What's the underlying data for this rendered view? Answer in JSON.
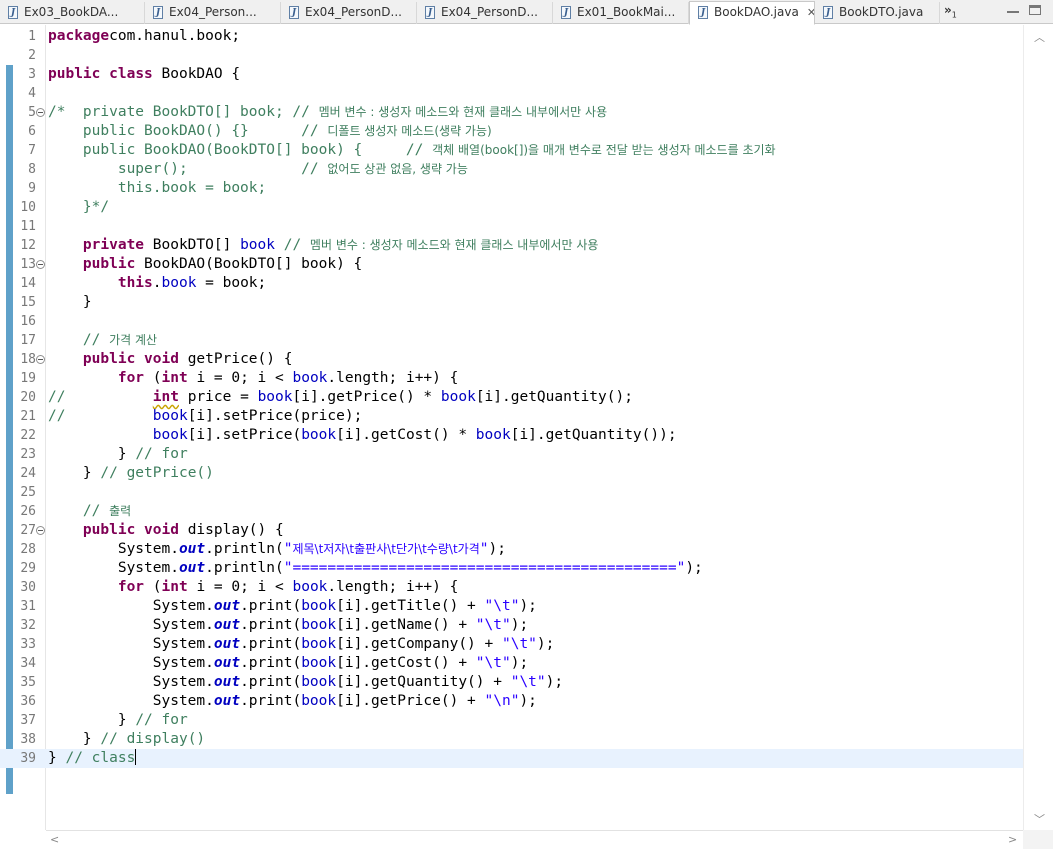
{
  "tabs": [
    {
      "label": "Ex03_BookDA...",
      "active": false
    },
    {
      "label": "Ex04_Person...",
      "active": false
    },
    {
      "label": "Ex04_PersonD...",
      "active": false
    },
    {
      "label": "Ex04_PersonD...",
      "active": false
    },
    {
      "label": "Ex01_BookMai...",
      "active": false
    },
    {
      "label": "BookDAO.java",
      "active": true
    },
    {
      "label": "BookDTO.java",
      "active": false
    }
  ],
  "tab_overflow": {
    "glyph": "»",
    "count": "1"
  },
  "editor": {
    "current_line": 39,
    "folding_lines": [
      5,
      13,
      18,
      27
    ],
    "lines": [
      {
        "n": "1",
        "tokens": [
          [
            "kw",
            "package"
          ],
          [
            "",
            "com.hanul.book;"
          ]
        ]
      },
      {
        "n": "2",
        "tokens": []
      },
      {
        "n": "3",
        "tokens": [
          [
            "kw",
            "public"
          ],
          [
            "",
            " "
          ],
          [
            "kw",
            "class"
          ],
          [
            "",
            " BookDAO {"
          ]
        ]
      },
      {
        "n": "4",
        "tokens": []
      },
      {
        "n": "5",
        "tokens": [
          [
            "cm",
            "/*  private BookDTO[] book; // "
          ],
          [
            "cmkr",
            "멤버 변수 : 생성자 메소드와 현재 클래스 내부에서만 사용"
          ]
        ]
      },
      {
        "n": "6",
        "tokens": [
          [
            "cm",
            "    public BookDAO() {}      // "
          ],
          [
            "cmkr",
            "디폴트 생성자 메소드(생략 가능)"
          ]
        ]
      },
      {
        "n": "7",
        "tokens": [
          [
            "cm",
            "    public BookDAO(BookDTO[] book) {     // "
          ],
          [
            "cmkr",
            "객체 배열(book[])을 매개 변수로 전달 받는 생성자 메소드를 초기화"
          ]
        ]
      },
      {
        "n": "8",
        "tokens": [
          [
            "cm",
            "        super();             // "
          ],
          [
            "cmkr",
            "없어도 상관 없음, 생략 가능"
          ]
        ]
      },
      {
        "n": "9",
        "tokens": [
          [
            "cm",
            "        this.book = book;"
          ]
        ]
      },
      {
        "n": "10",
        "tokens": [
          [
            "cm",
            "    }*/"
          ]
        ]
      },
      {
        "n": "11",
        "tokens": []
      },
      {
        "n": "12",
        "tokens": [
          [
            "",
            "    "
          ],
          [
            "kw",
            "private"
          ],
          [
            "",
            " BookDTO[] "
          ],
          [
            "fd",
            "book"
          ],
          [
            "",
            " "
          ],
          [
            "cm",
            "// "
          ],
          [
            "cmkr",
            "멤버 변수 : 생성자 메소드와 현재 클래스 내부에서만 사용"
          ]
        ]
      },
      {
        "n": "13",
        "tokens": [
          [
            "",
            "    "
          ],
          [
            "kw",
            "public"
          ],
          [
            "",
            " BookDAO(BookDTO[] book) {"
          ]
        ]
      },
      {
        "n": "14",
        "tokens": [
          [
            "",
            "        "
          ],
          [
            "kw",
            "this"
          ],
          [
            "",
            "."
          ],
          [
            "fd",
            "book"
          ],
          [
            "",
            " = book;"
          ]
        ]
      },
      {
        "n": "15",
        "tokens": [
          [
            "",
            "    }"
          ]
        ]
      },
      {
        "n": "16",
        "tokens": []
      },
      {
        "n": "17",
        "tokens": [
          [
            "",
            "    "
          ],
          [
            "cm",
            "// "
          ],
          [
            "cmkr",
            "가격 계산"
          ]
        ]
      },
      {
        "n": "18",
        "tokens": [
          [
            "",
            "    "
          ],
          [
            "kw",
            "public"
          ],
          [
            "",
            " "
          ],
          [
            "kw",
            "void"
          ],
          [
            "",
            " getPrice() {"
          ]
        ]
      },
      {
        "n": "19",
        "tokens": [
          [
            "",
            "        "
          ],
          [
            "kw",
            "for"
          ],
          [
            "",
            " ("
          ],
          [
            "kw",
            "int"
          ],
          [
            "",
            " i = 0; i < "
          ],
          [
            "fd",
            "book"
          ],
          [
            "",
            ".length; i++) {"
          ]
        ]
      },
      {
        "n": "20",
        "tokens": [
          [
            "cm",
            "//"
          ],
          [
            "",
            "          "
          ],
          [
            "warnkw",
            "int"
          ],
          [
            "",
            " price = "
          ],
          [
            "fd",
            "book"
          ],
          [
            "",
            "[i].getPrice() * "
          ],
          [
            "fd",
            "book"
          ],
          [
            "",
            "[i].getQuantity();"
          ]
        ]
      },
      {
        "n": "21",
        "tokens": [
          [
            "cm",
            "//"
          ],
          [
            "",
            "          "
          ],
          [
            "fd",
            "book"
          ],
          [
            "",
            "[i].setPrice(price);"
          ]
        ]
      },
      {
        "n": "22",
        "tokens": [
          [
            "",
            "            "
          ],
          [
            "fd",
            "book"
          ],
          [
            "",
            "[i].setPrice("
          ],
          [
            "fd",
            "book"
          ],
          [
            "",
            "[i].getCost() * "
          ],
          [
            "fd",
            "book"
          ],
          [
            "",
            "[i].getQuantity());"
          ]
        ]
      },
      {
        "n": "23",
        "tokens": [
          [
            "",
            "        } "
          ],
          [
            "cm",
            "// for"
          ]
        ]
      },
      {
        "n": "24",
        "tokens": [
          [
            "",
            "    } "
          ],
          [
            "cm",
            "// getPrice()"
          ]
        ]
      },
      {
        "n": "25",
        "tokens": []
      },
      {
        "n": "26",
        "tokens": [
          [
            "",
            "    "
          ],
          [
            "cm",
            "// "
          ],
          [
            "cmkr",
            "출력"
          ]
        ]
      },
      {
        "n": "27",
        "tokens": [
          [
            "",
            "    "
          ],
          [
            "kw",
            "public"
          ],
          [
            "",
            " "
          ],
          [
            "kw",
            "void"
          ],
          [
            "",
            " display() {"
          ]
        ]
      },
      {
        "n": "28",
        "tokens": [
          [
            "",
            "        System."
          ],
          [
            "sf",
            "out"
          ],
          [
            "",
            ".println("
          ],
          [
            "st",
            "\""
          ],
          [
            "stkr",
            "제목\\t저자\\t출판사\\t단가\\t수량\\t가격"
          ],
          [
            "st",
            "\""
          ],
          [
            "",
            ");"
          ]
        ]
      },
      {
        "n": "29",
        "tokens": [
          [
            "",
            "        System."
          ],
          [
            "sf",
            "out"
          ],
          [
            "",
            ".println("
          ],
          [
            "st",
            "\"============================================\""
          ],
          [
            "",
            ");"
          ]
        ]
      },
      {
        "n": "30",
        "tokens": [
          [
            "",
            "        "
          ],
          [
            "kw",
            "for"
          ],
          [
            "",
            " ("
          ],
          [
            "kw",
            "int"
          ],
          [
            "",
            " i = 0; i < "
          ],
          [
            "fd",
            "book"
          ],
          [
            "",
            ".length; i++) {"
          ]
        ]
      },
      {
        "n": "31",
        "tokens": [
          [
            "",
            "            System."
          ],
          [
            "sf",
            "out"
          ],
          [
            "",
            ".print("
          ],
          [
            "fd",
            "book"
          ],
          [
            "",
            "[i].getTitle() + "
          ],
          [
            "st",
            "\"\\t\""
          ],
          [
            "",
            ");"
          ]
        ]
      },
      {
        "n": "32",
        "tokens": [
          [
            "",
            "            System."
          ],
          [
            "sf",
            "out"
          ],
          [
            "",
            ".print("
          ],
          [
            "fd",
            "book"
          ],
          [
            "",
            "[i].getName() + "
          ],
          [
            "st",
            "\"\\t\""
          ],
          [
            "",
            ");"
          ]
        ]
      },
      {
        "n": "33",
        "tokens": [
          [
            "",
            "            System."
          ],
          [
            "sf",
            "out"
          ],
          [
            "",
            ".print("
          ],
          [
            "fd",
            "book"
          ],
          [
            "",
            "[i].getCompany() + "
          ],
          [
            "st",
            "\"\\t\""
          ],
          [
            "",
            ");"
          ]
        ]
      },
      {
        "n": "34",
        "tokens": [
          [
            "",
            "            System."
          ],
          [
            "sf",
            "out"
          ],
          [
            "",
            ".print("
          ],
          [
            "fd",
            "book"
          ],
          [
            "",
            "[i].getCost() + "
          ],
          [
            "st",
            "\"\\t\""
          ],
          [
            "",
            ");"
          ]
        ]
      },
      {
        "n": "35",
        "tokens": [
          [
            "",
            "            System."
          ],
          [
            "sf",
            "out"
          ],
          [
            "",
            ".print("
          ],
          [
            "fd",
            "book"
          ],
          [
            "",
            "[i].getQuantity() + "
          ],
          [
            "st",
            "\"\\t\""
          ],
          [
            "",
            ");"
          ]
        ]
      },
      {
        "n": "36",
        "tokens": [
          [
            "",
            "            System."
          ],
          [
            "sf",
            "out"
          ],
          [
            "",
            ".print("
          ],
          [
            "fd",
            "book"
          ],
          [
            "",
            "[i].getPrice() + "
          ],
          [
            "st",
            "\"\\n\""
          ],
          [
            "",
            ");"
          ]
        ]
      },
      {
        "n": "37",
        "tokens": [
          [
            "",
            "        } "
          ],
          [
            "cm",
            "// for"
          ]
        ]
      },
      {
        "n": "38",
        "tokens": [
          [
            "",
            "    } "
          ],
          [
            "cm",
            "// display()"
          ]
        ]
      },
      {
        "n": "39",
        "tokens": [
          [
            "",
            "} "
          ],
          [
            "cm",
            "// class"
          ]
        ]
      }
    ]
  },
  "colors": {
    "keyword": "#7f0055",
    "comment": "#3f7f5f",
    "field": "#0000c0",
    "string": "#2a00ff",
    "current_line_bg": "#e8f2fe",
    "change_bar": "#5fa1c9"
  },
  "icons": {
    "java_file": "java-file-icon",
    "close": "close-icon",
    "fold": "fold-collapse-icon"
  }
}
